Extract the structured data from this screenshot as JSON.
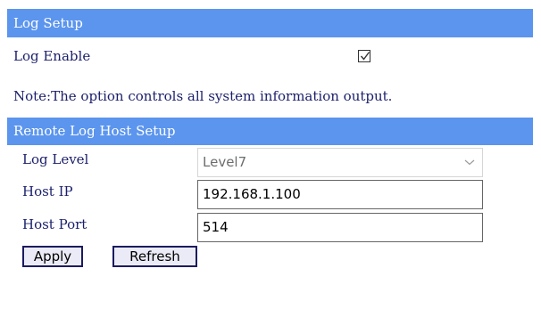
{
  "log_setup": {
    "title": "Log Setup",
    "log_enable_label": "Log Enable",
    "log_enable_checked": true,
    "note": "Note:The option controls all system information output."
  },
  "remote_log": {
    "title": "Remote Log Host Setup",
    "log_level_label": "Log Level",
    "log_level_value": "Level7",
    "host_ip_label": "Host IP",
    "host_ip_value": "192.168.1.100",
    "host_port_label": "Host Port",
    "host_port_value": "514"
  },
  "buttons": {
    "apply": "Apply",
    "refresh": "Refresh"
  },
  "colors": {
    "header_bg": "#5b95ee",
    "label_text": "#1a1f6b",
    "button_border": "#1b1b60"
  },
  "icons": {
    "checkbox": "checkmark-icon",
    "dropdown": "chevron-down-icon"
  }
}
